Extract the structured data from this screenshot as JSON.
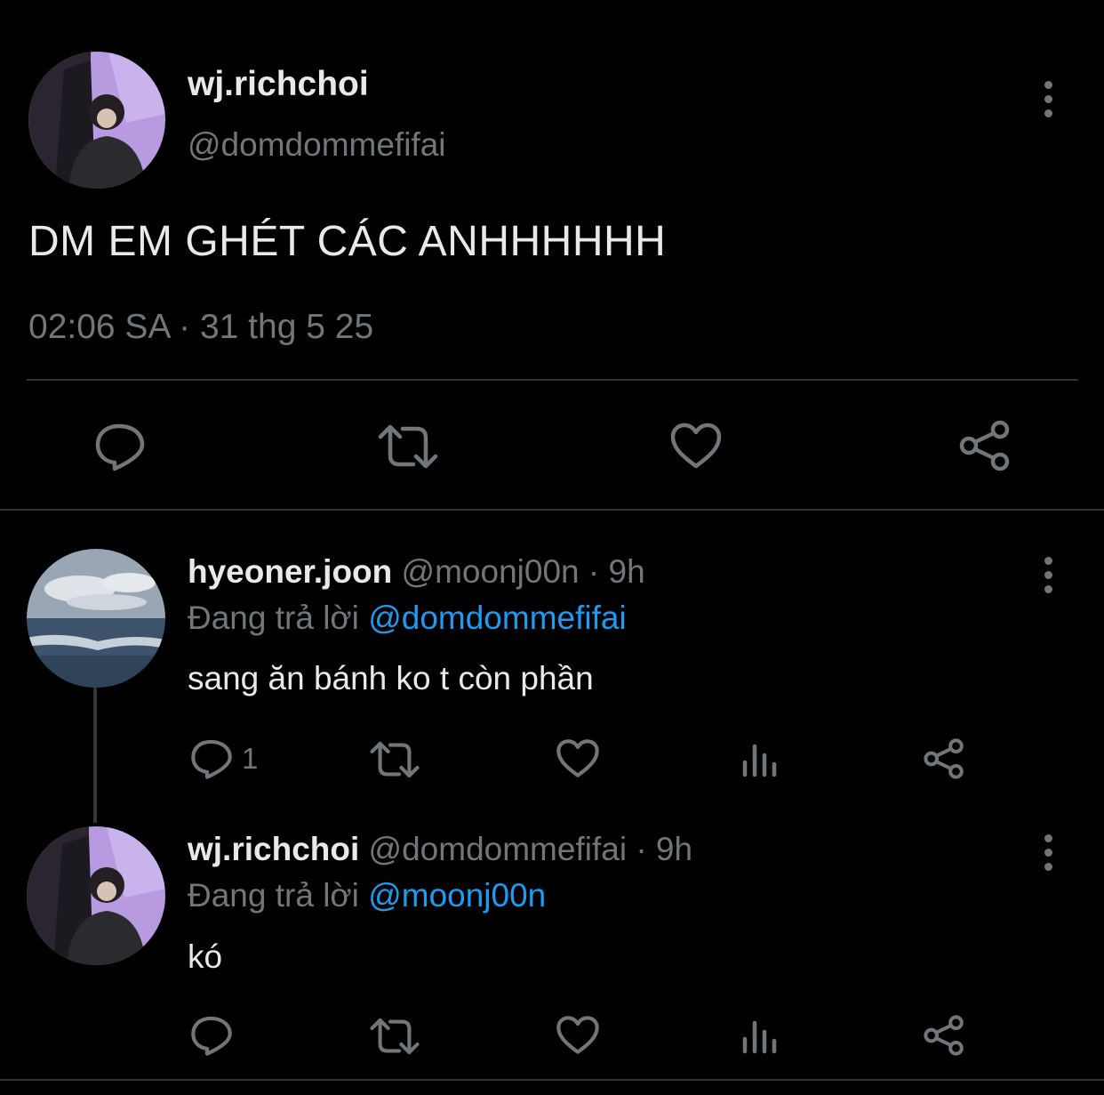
{
  "main_tweet": {
    "display_name": "wj.richchoi",
    "handle": "@domdommefifai",
    "text": "DM EM GHÉT CÁC ANHHHHHH",
    "timestamp": "02:06 SA · 31 thg 5 25",
    "actions": [
      "reply-icon",
      "retweet-icon",
      "like-icon",
      "share-icon"
    ]
  },
  "replies": [
    {
      "display_name": "hyeoner.joon",
      "handle_time": "@moonj00n · 9h",
      "replying_label": "Đang trả lời",
      "replying_to": "@domdommefifai",
      "text": "sang ăn bánh ko t còn phần",
      "reply_count": "1"
    },
    {
      "display_name": "wj.richchoi",
      "handle_time": "@domdommefifai · 9h",
      "replying_label": "Đang trả lời",
      "replying_to": "@moonj00n",
      "text": "kó"
    }
  ],
  "colors": {
    "background": "#000000",
    "text": "#e7e9ea",
    "muted": "#71767b",
    "link": "#1d9bf0",
    "divider": "#2f3336"
  }
}
